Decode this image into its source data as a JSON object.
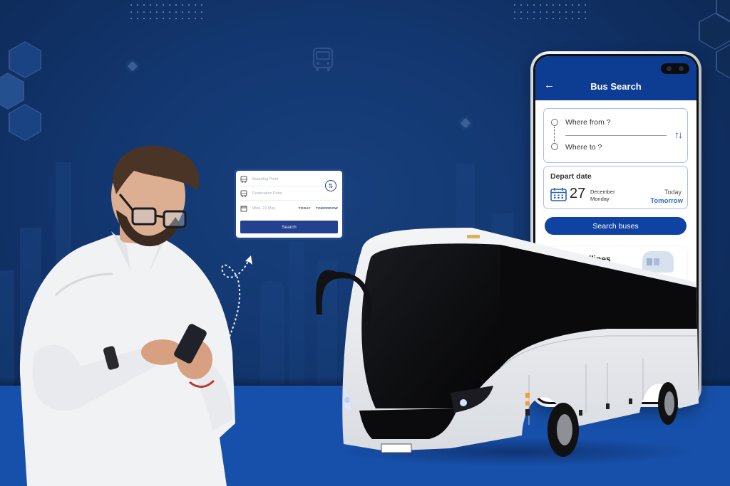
{
  "scene": {
    "description": "Bus booking app promotional banner",
    "colors": {
      "background": "#133872",
      "floor": "#1750aa",
      "app_bar": "#0d3c93",
      "primary_button": "#0e43a4",
      "accent_link": "#2c6bc4"
    }
  },
  "mini_search_card": {
    "boarding_placeholder": "Boarding Point",
    "destination_placeholder": "Destination Point",
    "date_value": "Wed, 22 May",
    "today_label": "TODAY",
    "tomorrow_label": "TOMORROW",
    "search_label": "Search",
    "icons": {
      "boarding": "bus-icon",
      "destination": "bus-icon",
      "date": "calendar-icon",
      "swap": "swap-vertical-icon"
    }
  },
  "phone_app": {
    "title": "Bus Search",
    "back_icon": "arrow-left-icon",
    "route": {
      "from_placeholder": "Where from ?",
      "to_placeholder": "Where to ?",
      "swap_icon": "↑↓"
    },
    "depart": {
      "label": "Depart date",
      "day": "27",
      "month": "December",
      "weekday": "Monday",
      "today": "Today",
      "tomorrow": "Tomorrow"
    },
    "search_button": "Search buses",
    "offers_title": "llines"
  }
}
